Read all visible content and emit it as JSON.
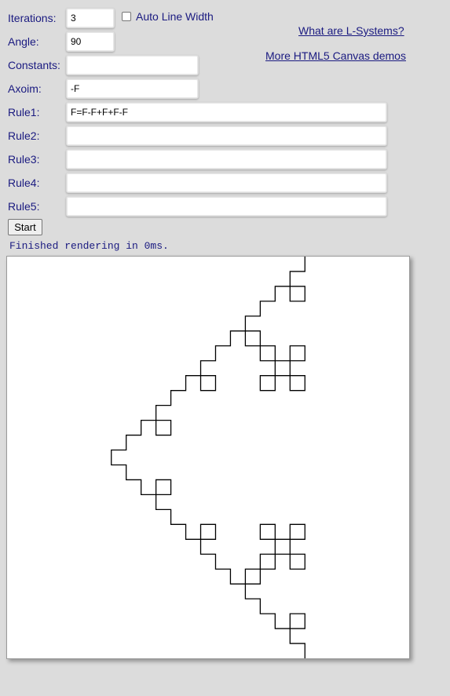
{
  "form": {
    "iterations": {
      "label": "Iterations:",
      "value": "3"
    },
    "auto_line_width": {
      "label": "Auto Line Width",
      "checked": false
    },
    "angle": {
      "label": "Angle:",
      "value": "90"
    },
    "constants": {
      "label": "Constants:",
      "value": ""
    },
    "axiom": {
      "label": "Axoim:",
      "value": "-F"
    },
    "rules": [
      {
        "label": "Rule1:",
        "value": "F=F-F+F+F-F"
      },
      {
        "label": "Rule2:",
        "value": ""
      },
      {
        "label": "Rule3:",
        "value": ""
      },
      {
        "label": "Rule4:",
        "value": ""
      },
      {
        "label": "Rule5:",
        "value": ""
      }
    ],
    "start_label": "Start"
  },
  "links": {
    "what_are": "What are L-Systems?",
    "more_demos": "More HTML5 Canvas demos"
  },
  "status": "Finished rendering in 0ms.",
  "colors": {
    "background": "#dcdcdc",
    "label_text": "#1a1a80",
    "canvas_bg": "#ffffff",
    "line": "#000000"
  }
}
